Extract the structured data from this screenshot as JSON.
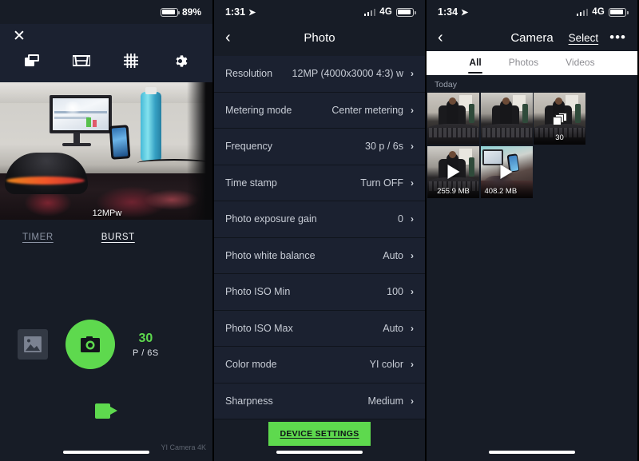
{
  "panel1": {
    "status": {
      "battery_pct": "89%"
    },
    "close_label": "✕",
    "toolbar": [
      {
        "name": "camera-mode-icon"
      },
      {
        "name": "lens-view-icon"
      },
      {
        "name": "grid-icon"
      },
      {
        "name": "settings-gear-icon"
      }
    ],
    "preview_label": "12MPw",
    "modes": [
      {
        "label": "TIMER",
        "active": false
      },
      {
        "label": "BURST",
        "active": true
      }
    ],
    "burst": {
      "count": "30",
      "unit": "P / 6S"
    },
    "watermark": "YI Camera 4K"
  },
  "panel2": {
    "status": {
      "time": "1:31",
      "network": "4G"
    },
    "nav": {
      "back": "‹",
      "title": "Photo"
    },
    "rows": [
      {
        "label": "Resolution",
        "value": "12MP (4000x3000 4:3) w"
      },
      {
        "label": "Metering mode",
        "value": "Center metering"
      },
      {
        "label": "Frequency",
        "value": "30 p / 6s"
      },
      {
        "label": "Time stamp",
        "value": "Turn OFF"
      },
      {
        "label": "Photo exposure gain",
        "value": "0"
      },
      {
        "label": "Photo white balance",
        "value": "Auto"
      },
      {
        "label": "Photo ISO Min",
        "value": "100"
      },
      {
        "label": "Photo ISO Max",
        "value": "Auto"
      },
      {
        "label": "Color mode",
        "value": "YI color"
      },
      {
        "label": "Sharpness",
        "value": "Medium"
      }
    ],
    "device_settings_label": "DEVICE SETTINGS"
  },
  "panel3": {
    "status": {
      "time": "1:34",
      "network": "4G"
    },
    "nav": {
      "back": "‹",
      "title": "Camera",
      "select": "Select",
      "more": "•••"
    },
    "tabs": [
      {
        "label": "All",
        "active": true
      },
      {
        "label": "Photos",
        "active": false
      },
      {
        "label": "Videos",
        "active": false
      }
    ],
    "section_label": "Today",
    "items": [
      {
        "caption": "",
        "overlay": "none"
      },
      {
        "caption": "",
        "overlay": "none"
      },
      {
        "caption": "30",
        "overlay": "burst"
      },
      {
        "caption": "255.9 MB",
        "overlay": "video"
      },
      {
        "caption": "408.2 MB",
        "overlay": "video"
      }
    ]
  },
  "colors": {
    "accent_green": "#5ed94e",
    "panel_bg": "#1b2130",
    "status_bg": "#171c26",
    "text_primary": "#ffffff",
    "text_secondary": "#c8cdd6",
    "tabbar_bg": "#ffffff"
  }
}
